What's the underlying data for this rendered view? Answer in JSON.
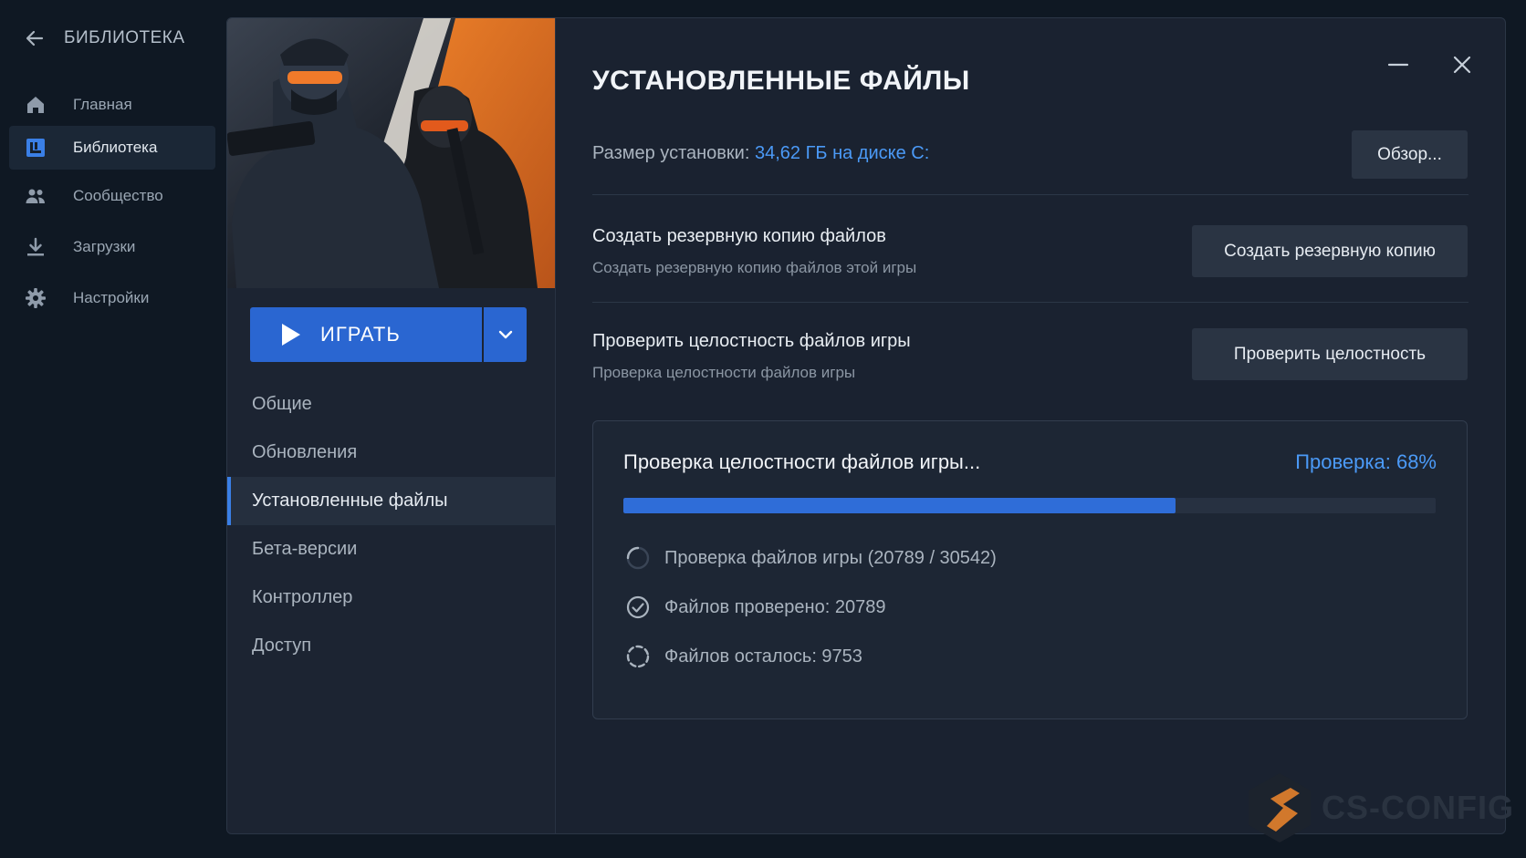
{
  "sidebar": {
    "back_label": "БИБЛИОТЕКА",
    "items": [
      {
        "label": "Главная",
        "icon": "home-icon"
      },
      {
        "label": "Библиотека",
        "icon": "library-icon",
        "active": true
      },
      {
        "label": "Сообщество",
        "icon": "community-icon"
      },
      {
        "label": "Загрузки",
        "icon": "download-icon"
      },
      {
        "label": "Настройки",
        "icon": "gear-icon"
      }
    ]
  },
  "game": {
    "play_label": "ИГРАТЬ"
  },
  "settings_menu": {
    "items": [
      {
        "label": "Общие"
      },
      {
        "label": "Обновления"
      },
      {
        "label": "Установленные файлы",
        "active": true
      },
      {
        "label": "Бета-версии"
      },
      {
        "label": "Контроллер"
      },
      {
        "label": "Доступ"
      }
    ]
  },
  "dialog": {
    "title": "УСТАНОВЛЕННЫЕ ФАЙЛЫ",
    "install_size_label": "Размер установки:",
    "install_size_value": "34,62 ГБ на диске C:",
    "browse_label": "Обзор...",
    "backup": {
      "title": "Создать резервную копию файлов",
      "description": "Создать резервную копию файлов этой игры",
      "button": "Создать резервную копию"
    },
    "verify": {
      "title": "Проверить целостность файлов игры",
      "description": "Проверка целостности файлов игры",
      "button": "Проверить целостность"
    }
  },
  "verification": {
    "title": "Проверка целостности файлов игры...",
    "status": "Проверка: 68%",
    "progress_percent": 68,
    "stats": [
      {
        "text": "Проверка файлов игры (20789 / 30542)",
        "icon": "spinner-icon"
      },
      {
        "text": "Файлов проверено: 20789",
        "icon": "check-circle-icon"
      },
      {
        "text": "Файлов осталось: 9753",
        "icon": "dashed-circle-icon"
      }
    ]
  },
  "watermark": {
    "text": "CS-CONFIG"
  },
  "colors": {
    "accent": "#2a66d1",
    "link": "#4b9af7",
    "background": "#0f1823",
    "panel": "#1a2230"
  }
}
